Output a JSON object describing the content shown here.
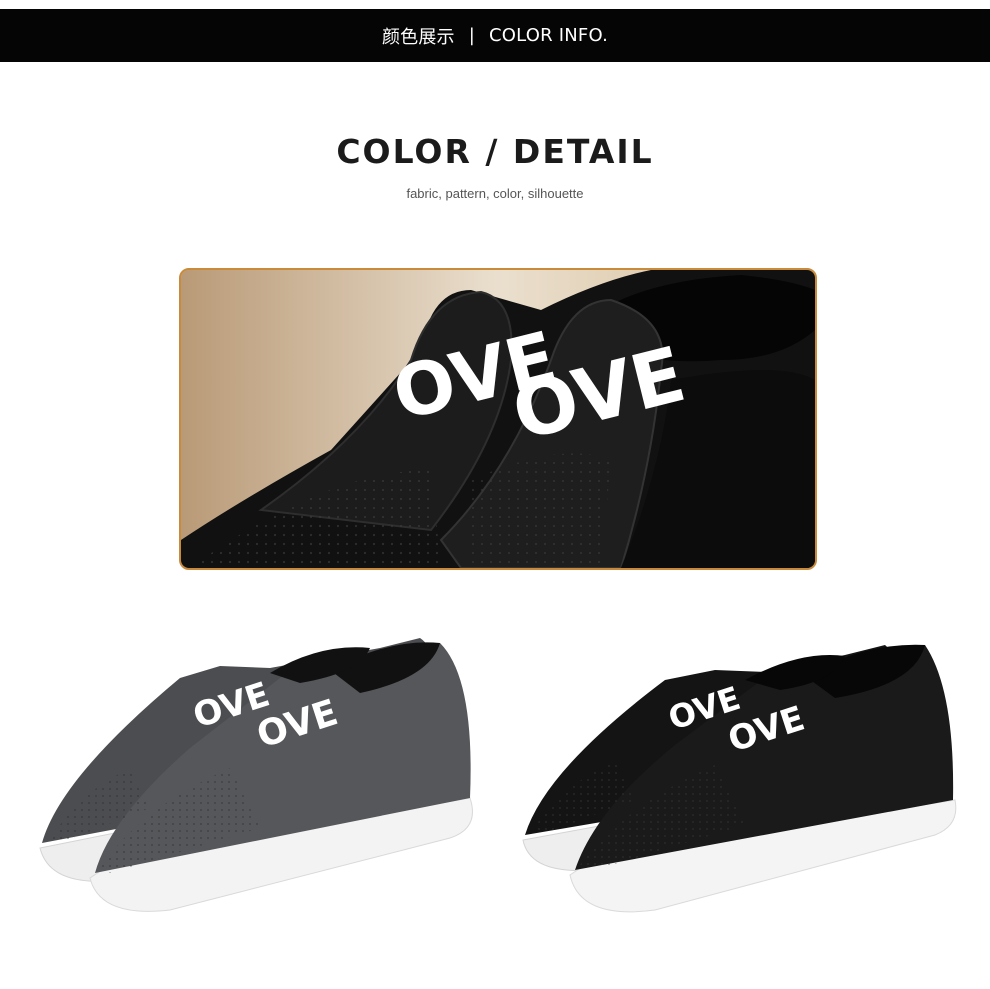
{
  "header": {
    "chinese_label": "颜色展示",
    "separator": "|",
    "english_label": "COLOR INFO."
  },
  "section": {
    "title": "COLOR / DETAIL",
    "subtitle": "fabric, pattern, color, silhouette"
  },
  "product_images": {
    "detail_print_text": "OVE",
    "variants": [
      {
        "color_name": "gunmetal",
        "upper": "#4c4d50"
      },
      {
        "color_name": "black",
        "upper": "#141414"
      }
    ],
    "accent": "#c98a3a"
  }
}
